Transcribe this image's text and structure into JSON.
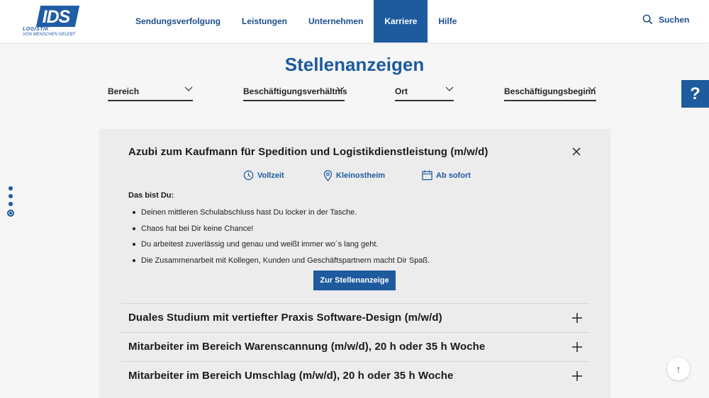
{
  "header": {
    "logo_text": "IDS",
    "logo_sub1": "LOGISTIK",
    "logo_sub2": "VON MENSCHEN GELEBT",
    "nav": [
      {
        "label": "Sendungsverfolgung"
      },
      {
        "label": "Leistungen"
      },
      {
        "label": "Unternehmen"
      },
      {
        "label": "Karriere",
        "active": true
      },
      {
        "label": "Hilfe"
      }
    ],
    "search_label": "Suchen",
    "search_icon": "search-icon"
  },
  "page_title": "Stellenanzeigen",
  "filters": [
    {
      "label": "Bereich"
    },
    {
      "label": "Beschäftigungsverhältnis"
    },
    {
      "label": "Ort"
    },
    {
      "label": "Beschäftigungsbeginn"
    }
  ],
  "help_tab": "?",
  "open_job": {
    "title": "Azubi zum Kaufmann für Spedition und Logistikdienstleistung (m/w/d)",
    "employment": "Vollzeit",
    "location": "Kleinostheim",
    "start": "Ab sofort",
    "profile_heading": "Das bist Du:",
    "bullets": [
      "Deinen mittleren Schulabschluss hast Du locker in der Tasche.",
      "Chaos hat bei Dir keine Chance!",
      "Du arbeitest zuverlässig und genau und weißt immer wo´s lang geht.",
      "Die Zusammenarbeit mit Kollegen, Kunden und Geschäftspartnern macht Dir Spaß."
    ],
    "cta_label": "Zur Stellenanzeige"
  },
  "collapsed_jobs": [
    {
      "title": "Duales Studium mit vertiefter Praxis Software-Design (m/w/d)"
    },
    {
      "title": "Mitarbeiter im Bereich Warenscannung (m/w/d), 20 h oder 35 h Woche"
    },
    {
      "title": "Mitarbeiter im Bereich Umschlag (m/w/d), 20 h oder 35 h Woche"
    }
  ],
  "scroll_top_icon": "↑",
  "colors": {
    "brand": "#1d5a9e",
    "background": "#f6f6f6",
    "panel": "#ececec"
  }
}
